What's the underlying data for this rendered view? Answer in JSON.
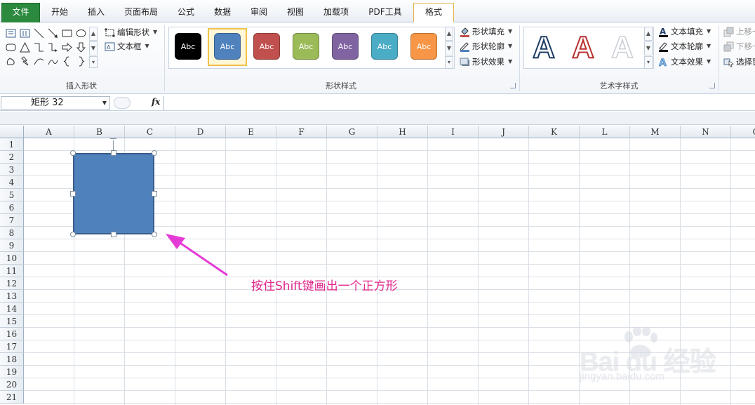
{
  "tabs": [
    "文件",
    "开始",
    "插入",
    "页面布局",
    "公式",
    "数据",
    "审阅",
    "视图",
    "加载项",
    "PDF工具",
    "格式"
  ],
  "active_tab": "格式",
  "ribbon": {
    "insert_shapes": {
      "label": "插入形状",
      "edit_shape": "编辑形状",
      "text_box": "文本框"
    },
    "shape_styles": {
      "label": "形状样式",
      "sample_text": "Abc",
      "swatches": [
        "#000000",
        "#4f81bd",
        "#c0504d",
        "#9bbb59",
        "#8064a2",
        "#4bacc6",
        "#f79646"
      ],
      "shape_fill": "形状填充",
      "shape_outline": "形状轮廓",
      "shape_effects": "形状效果"
    },
    "wordart_styles": {
      "label": "艺术字样式",
      "sample": "A",
      "text_fill": "文本填充",
      "text_outline": "文本轮廓",
      "text_effects": "文本效果"
    },
    "arrange": {
      "bring_forward": "上移一",
      "send_backward": "下移一",
      "selection_pane": "选择窗"
    }
  },
  "name_box": "矩形 32",
  "fx_label": "fx",
  "columns": [
    "A",
    "B",
    "C",
    "D",
    "E",
    "F",
    "G",
    "H",
    "I",
    "J",
    "K",
    "L",
    "M",
    "N",
    "O"
  ],
  "rows": [
    "1",
    "2",
    "3",
    "4",
    "5",
    "6",
    "7",
    "8",
    "9",
    "10",
    "11",
    "12",
    "13",
    "14",
    "15",
    "16",
    "17",
    "18",
    "19",
    "20",
    "21"
  ],
  "shape_color": "#4f81bd",
  "annotation": "按住Shift键画出一个正方形",
  "annotation_color": "#e0288d",
  "watermark": {
    "brand": "Bai du 经验",
    "url": "jingyan.baidu.com"
  }
}
